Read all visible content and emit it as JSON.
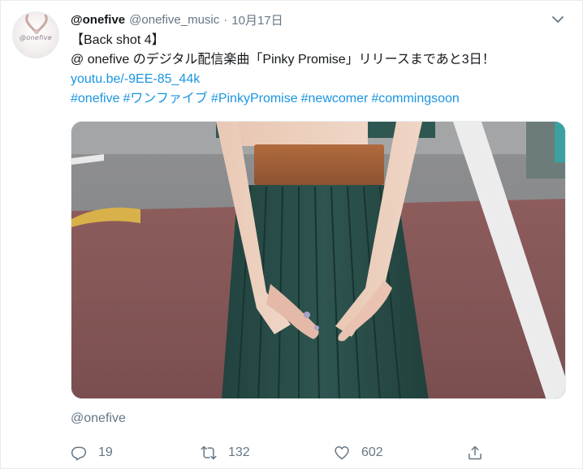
{
  "tweet": {
    "display_name": "@onefive",
    "screen_name": "@onefive_music",
    "separator": "·",
    "timestamp": "10月17日",
    "avatar_text": "@onefive",
    "line1": "【Back shot 4】",
    "line2": "@ onefive のデジタル配信楽曲「Pinky Promise」リリースまであと3日！",
    "link": "youtu.be/-9EE-85_44k",
    "hashtags": [
      "#onefive",
      "#ワンファイブ",
      "#PinkyPromise",
      "#newcomer",
      "#commingsoon"
    ],
    "quote_link": "@onefive"
  },
  "actions": {
    "replies": "19",
    "retweets": "132",
    "likes": "602"
  },
  "icons": {
    "reply": "reply-icon",
    "retweet": "retweet-icon",
    "like": "heart-icon",
    "share": "share-icon",
    "caret": "chevron-down-icon"
  },
  "colors": {
    "link": "#1b95e0",
    "muted": "#657786",
    "text": "#14171a"
  }
}
